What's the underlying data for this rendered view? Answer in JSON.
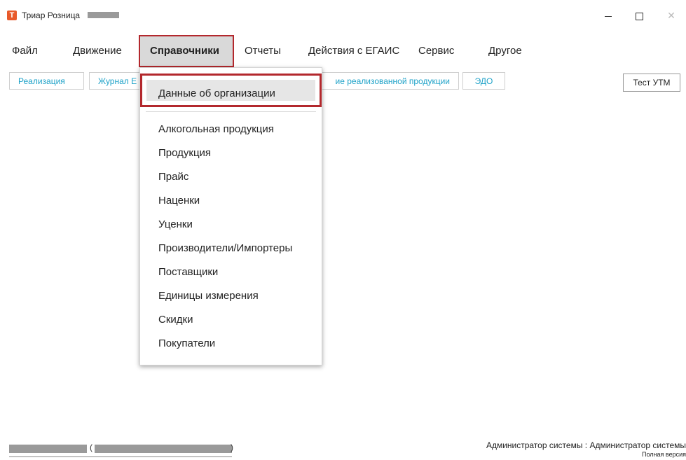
{
  "window": {
    "title": "Триар Розница",
    "app_icon_glyph": "T",
    "icon_name": "triar-app-icon"
  },
  "menubar": {
    "items": [
      {
        "label": "Файл"
      },
      {
        "label": "Движение"
      },
      {
        "label": "Справочники"
      },
      {
        "label": "Отчеты"
      },
      {
        "label": "Действия с ЕГАИС"
      },
      {
        "label": "Сервис"
      },
      {
        "label": "Другое"
      }
    ],
    "active_index": 2
  },
  "toolbar": {
    "buttons": [
      {
        "label": "Реализация"
      },
      {
        "label": "Журнал Е"
      },
      {
        "label": "ие реализованной продукции"
      },
      {
        "label": "ЭДО"
      }
    ],
    "utm_label": "Тест УТМ"
  },
  "dropdown": {
    "highlighted": "Данные об организации",
    "items": [
      "Алкогольная продукция",
      "Продукция",
      "Прайс",
      "Наценки",
      "Уценки",
      "Производители/Импортеры",
      "Поставщики",
      "Единицы измерения",
      "Скидки",
      "Покупатели"
    ]
  },
  "status": {
    "paren_open": "(",
    "paren_close": ")",
    "user": "Администратор системы : Администратор системы",
    "version": "Полная версия"
  },
  "colors": {
    "accent_link": "#1ea2c8",
    "highlight_border": "#b3282d",
    "app_icon": "#e8592a"
  }
}
